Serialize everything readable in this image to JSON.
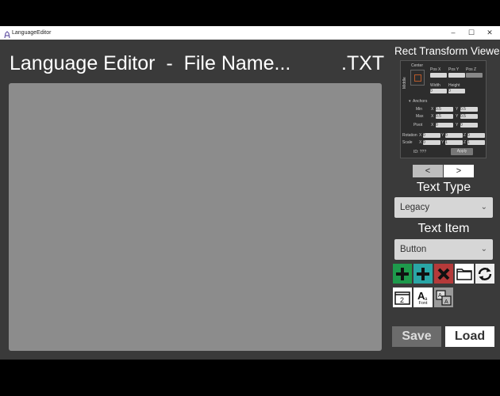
{
  "window": {
    "title": "LanguageEditor",
    "minimize": "–",
    "maximize": "☐",
    "close": "✕"
  },
  "editor": {
    "title": "Language Editor  -  File Name...",
    "extension": ".TXT"
  },
  "rect_transform": {
    "title": "Rect Transform Viewer",
    "center": "Center",
    "middle": "Middle",
    "pos_x": "Pos X",
    "pos_y": "Pos Y",
    "pos_z": "Pos Z",
    "width": "Width",
    "height": "Height",
    "width_value": "0",
    "height_value": "0",
    "anchors": "Anchors",
    "min": "Min",
    "max": "Max",
    "pivot": "Pivot",
    "x": "X",
    "y": "Y",
    "z": "Z",
    "min_x": "0.5",
    "min_y": "0.5",
    "max_x": "0.5",
    "max_y": "0.5",
    "pivot_x": "0",
    "pivot_y": "0",
    "rotation": "Rotation",
    "scale": "Scale",
    "rot_x": "0",
    "rot_y": "0",
    "rot_z": "0",
    "scale_x": "0",
    "scale_y": "1",
    "scale_z": "1",
    "id": "ID: ???",
    "apply": "Apply"
  },
  "nav": {
    "prev": "<",
    "next": ">"
  },
  "text_type": {
    "label": "Text Type",
    "selected": "Legacy"
  },
  "text_item": {
    "label": "Text Item",
    "selected": "Button"
  },
  "tools": {
    "font_label": "Font",
    "count_badge": "2"
  },
  "actions": {
    "save": "Save",
    "load": "Load"
  },
  "colors": {
    "add_green": "#1e9a4c",
    "add_teal": "#2aa6a6",
    "delete_red": "#b53a3a"
  }
}
